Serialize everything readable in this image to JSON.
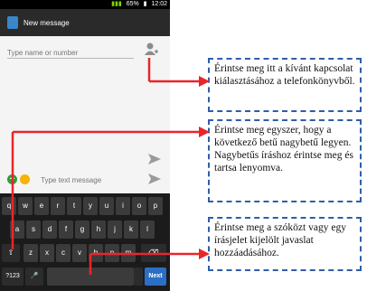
{
  "status_bar": {
    "battery": "65%",
    "time": "12:02"
  },
  "app_bar": {
    "title": "New message"
  },
  "recipient": {
    "placeholder": "Type name or number"
  },
  "composer": {
    "placeholder": "Type text message"
  },
  "keyboard": {
    "row1": [
      "q",
      "w",
      "e",
      "r",
      "t",
      "y",
      "u",
      "i",
      "o",
      "p"
    ],
    "row2": [
      "a",
      "s",
      "d",
      "f",
      "g",
      "h",
      "j",
      "k",
      "l"
    ],
    "row3": [
      "z",
      "x",
      "c",
      "v",
      "b",
      "n",
      "m"
    ],
    "shift": "⇧",
    "backspace": "⌫",
    "symbols": "?123",
    "mic": "🎤",
    "next": "Next"
  },
  "callouts": {
    "contacts": "Érintse meg itt a kívánt kapcsolat kiálasztásához a telefonkönyvből.",
    "shift": "Érintse meg egyszer, hogy a következő betű nagybetű legyen. Nagybetűs íráshoz érintse meg és tartsa lenyomva.",
    "space": "Érintse meg a szóközt vagy egy írásjelet kijelölt javaslat hozzáadásához."
  },
  "colors": {
    "arrow": "#e8262a",
    "callout_border": "#2f5ea8",
    "next_key": "#2b6fc5"
  }
}
